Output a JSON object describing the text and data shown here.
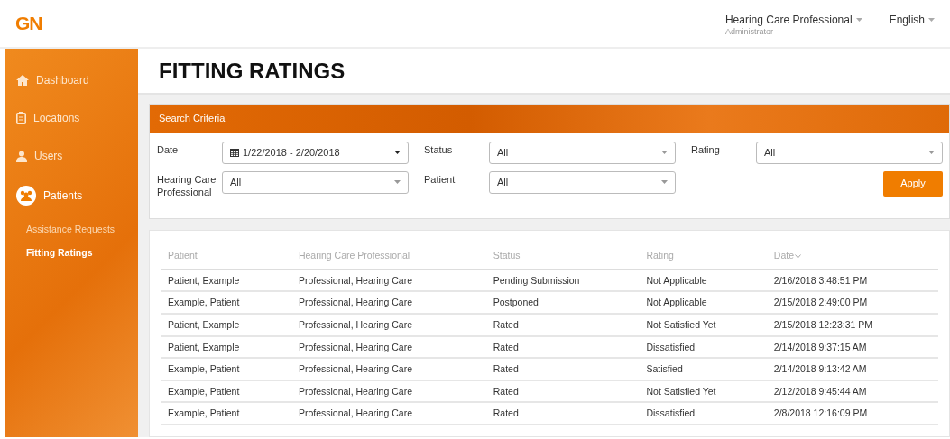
{
  "header": {
    "logo": "GN",
    "user_menu": {
      "label": "Hearing Care Professional",
      "role": "Administrator"
    },
    "language_menu": {
      "label": "English"
    }
  },
  "sidebar": {
    "items": [
      {
        "label": "Dashboard",
        "kind": "home",
        "selected": false
      },
      {
        "label": "Locations",
        "kind": "clipboard",
        "selected": false
      },
      {
        "label": "Users",
        "kind": "user",
        "selected": false
      },
      {
        "label": "Patients",
        "kind": "group",
        "selected": true,
        "children": [
          {
            "label": "Assistance Requests",
            "selected": false
          },
          {
            "label": "Fitting Ratings",
            "selected": true
          }
        ]
      }
    ]
  },
  "page_title": "FITTING RATINGS",
  "search_criteria": {
    "title": "Search Criteria",
    "fields": [
      {
        "label": "Date",
        "value": "1/22/2018 - 2/20/2018",
        "kind": "daterange"
      },
      {
        "label": "Status",
        "value": "All",
        "kind": "select"
      },
      {
        "label": "Rating",
        "value": "All",
        "kind": "select"
      },
      {
        "label": "Hearing Care Professional",
        "value": "All",
        "kind": "select"
      },
      {
        "label": "Patient",
        "value": "All",
        "kind": "select"
      }
    ],
    "apply_button": "Apply"
  },
  "table": {
    "columns": [
      {
        "label": "Patient",
        "sorted": false
      },
      {
        "label": "Hearing Care Professional",
        "sorted": false
      },
      {
        "label": "Status",
        "sorted": false
      },
      {
        "label": "Rating",
        "sorted": false
      },
      {
        "label": "Date",
        "sorted": true
      }
    ],
    "rows": [
      [
        "Patient, Example",
        "Professional, Hearing Care",
        "Pending Submission",
        "Not Applicable",
        "2/16/2018 3:48:51 PM"
      ],
      [
        "Example, Patient",
        "Professional, Hearing Care",
        "Postponed",
        "Not Applicable",
        "2/15/2018 2:49:00 PM"
      ],
      [
        "Patient, Example",
        "Professional, Hearing Care",
        "Rated",
        "Not Satisfied Yet",
        "2/15/2018 12:23:31 PM"
      ],
      [
        "Patient, Example",
        "Professional, Hearing Care",
        "Rated",
        "Dissatisfied",
        "2/14/2018 9:37:15 AM"
      ],
      [
        "Example, Patient",
        "Professional, Hearing Care",
        "Rated",
        "Satisfied",
        "2/14/2018 9:13:42 AM"
      ],
      [
        "Example, Patient",
        "Professional, Hearing Care",
        "Rated",
        "Not Satisfied Yet",
        "2/12/2018 9:45:44 AM"
      ],
      [
        "Example, Patient",
        "Professional, Hearing Care",
        "Rated",
        "Dissatisfied",
        "2/8/2018 12:16:09 PM"
      ]
    ]
  }
}
